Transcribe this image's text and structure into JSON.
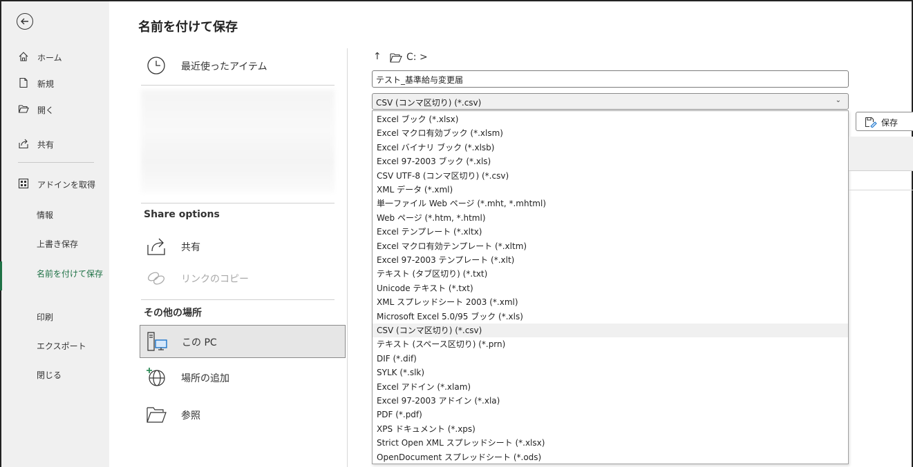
{
  "header": {
    "title": "名前を付けて保存"
  },
  "leftnav": {
    "items": [
      {
        "name": "home",
        "label": "ホーム"
      },
      {
        "name": "new",
        "label": "新規"
      },
      {
        "name": "open",
        "label": "開く"
      },
      {
        "name": "share",
        "label": "共有"
      },
      {
        "name": "addins",
        "label": "アドインを取得"
      },
      {
        "name": "info",
        "label": "情報"
      },
      {
        "name": "save",
        "label": "上書き保存"
      },
      {
        "name": "saveas",
        "label": "名前を付けて保存"
      },
      {
        "name": "print",
        "label": "印刷"
      },
      {
        "name": "export",
        "label": "エクスポート"
      },
      {
        "name": "close",
        "label": "閉じる"
      }
    ]
  },
  "locations": {
    "recent": "最近使ったアイテム",
    "share_header": "Share options",
    "share": "共有",
    "copy_link": "リンクのコピー",
    "other_header": "その他の場所",
    "this_pc": "この PC",
    "add_place": "場所の追加",
    "browse": "参照"
  },
  "path": {
    "up": "↑",
    "text": "C: >"
  },
  "file": {
    "name": "テスト_基準給与変更届",
    "type": "CSV (コンマ区切り) (*.csv)",
    "options": [
      "Excel ブック (*.xlsx)",
      "Excel マクロ有効ブック (*.xlsm)",
      "Excel バイナリ ブック (*.xlsb)",
      "Excel 97-2003 ブック (*.xls)",
      "CSV UTF-8 (コンマ区切り) (*.csv)",
      "XML データ (*.xml)",
      "単一ファイル Web ページ (*.mht, *.mhtml)",
      "Web ページ (*.htm, *.html)",
      "Excel テンプレート (*.xltx)",
      "Excel マクロ有効テンプレート (*.xltm)",
      "Excel 97-2003 テンプレート (*.xlt)",
      "テキスト (タブ区切り) (*.txt)",
      "Unicode テキスト (*.txt)",
      "XML スプレッドシート 2003 (*.xml)",
      "Microsoft Excel 5.0/95 ブック (*.xls)",
      "CSV (コンマ区切り) (*.csv)",
      "テキスト (スペース区切り) (*.prn)",
      "DIF (*.dif)",
      "SYLK (*.slk)",
      "Excel アドイン (*.xlam)",
      "Excel 97-2003 アドイン (*.xla)",
      "PDF (*.pdf)",
      "XPS ドキュメント (*.xps)",
      "Strict Open XML スプレッドシート (*.xlsx)",
      "OpenDocument スプレッドシート (*.ods)"
    ],
    "highlighted_index": 15
  },
  "buttons": {
    "save": "保存"
  },
  "colors": {
    "accent": "#1e7145",
    "nav_bg": "#f0f0f0"
  }
}
